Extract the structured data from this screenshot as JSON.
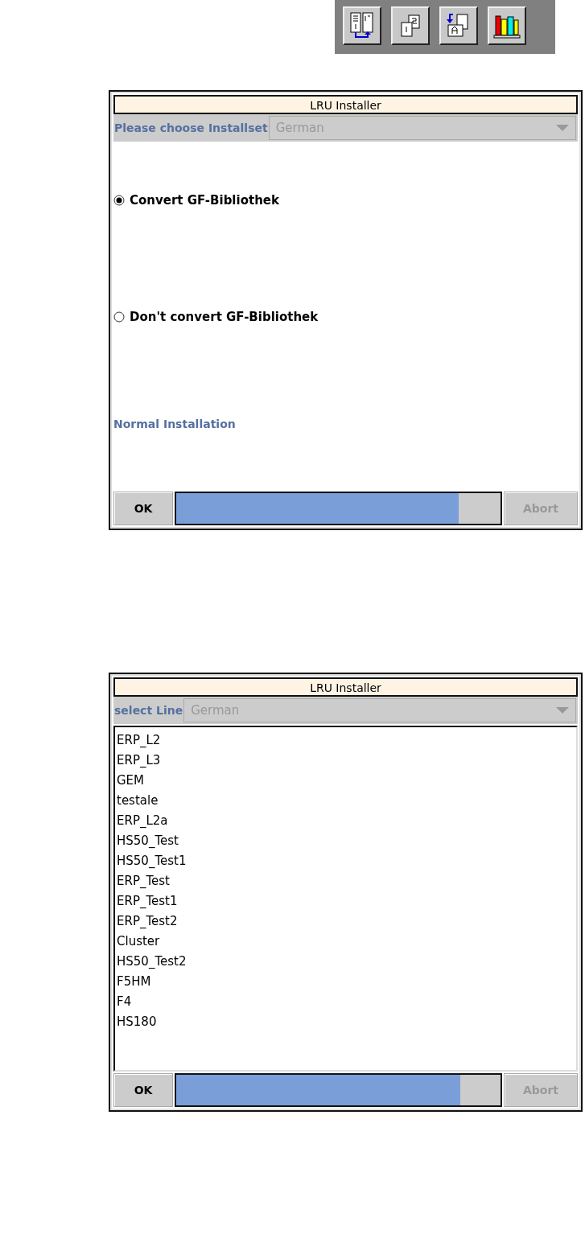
{
  "dialogs": [
    {
      "kind": "options",
      "title": "LRU Installer",
      "combo": {
        "label": "Please choose Installset",
        "value": "German",
        "disabled": true
      },
      "options": [
        {
          "label": "Convert GF-Bibliothek",
          "selected": true
        },
        {
          "label": "Don't convert GF-Bibliothek",
          "selected": false
        }
      ],
      "note": "Normal Installation",
      "ok": {
        "label": "OK",
        "disabled": false
      },
      "progress": {
        "level": 0.87
      },
      "abort": {
        "label": "Abort",
        "disabled": true
      }
    },
    {
      "kind": "list",
      "title": "LRU Installer",
      "combo": {
        "label": "select Line",
        "value": "German",
        "disabled": true
      },
      "items": [
        "ERP_L2",
        "ERP_L3",
        "GEM",
        "testale",
        "ERP_L2a",
        "HS50_Test",
        "HS50_Test1",
        "ERP_Test",
        "ERP_Test1",
        "ERP_Test2",
        "Cluster",
        "HS50_Test2",
        "F5HM",
        "F4",
        "HS180"
      ],
      "ok": {
        "label": "OK",
        "disabled": false
      },
      "progress": {
        "level": 0.875
      },
      "abort": {
        "label": "Abort",
        "disabled": true
      }
    }
  ]
}
